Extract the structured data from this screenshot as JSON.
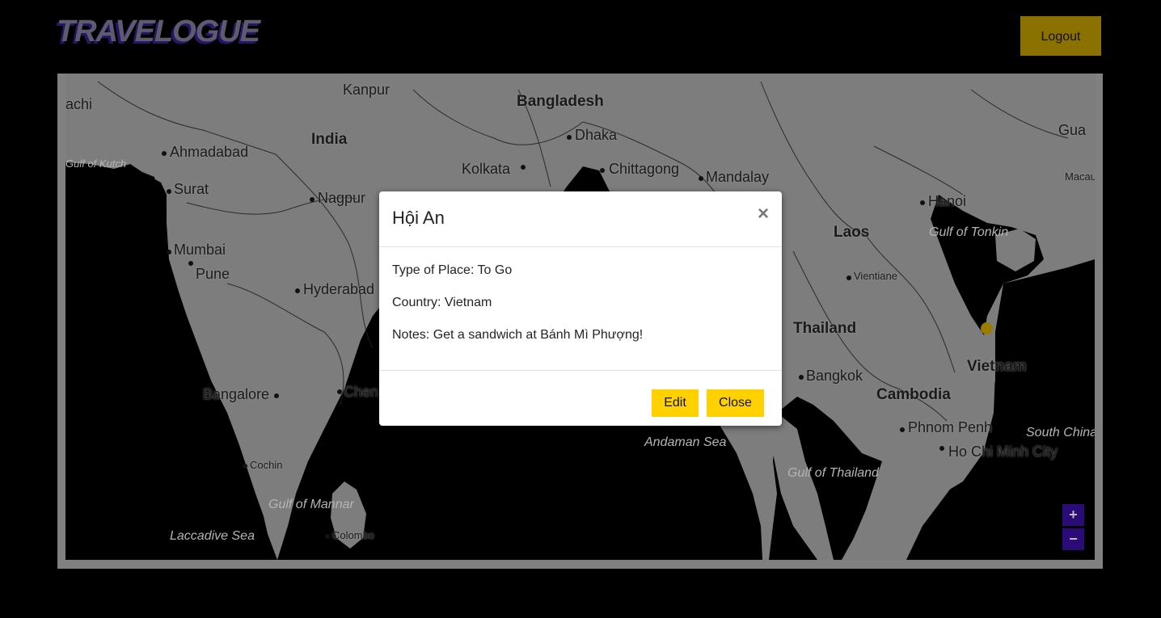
{
  "app": {
    "title": "TRAVELOGUE"
  },
  "header": {
    "logout_label": "Logout"
  },
  "map": {
    "labels": {
      "achi": "achi",
      "kanpur": "Kanpur",
      "bangladesh": "Bangladesh",
      "india": "India",
      "dhaka": "Dhaka",
      "ahmadabad": "Ahmadabad",
      "gulf_kutch": "Gulf of Kutch",
      "kolkata": "Kolkata",
      "chittagong": "Chittagong",
      "mandalay": "Mandalay",
      "gua": "Gua",
      "macau": "Macau",
      "surat": "Surat",
      "nagpur": "Nagpur",
      "hanoi": "Hanoi",
      "mumbai": "Mumbai",
      "laos": "Laos",
      "gulf_tonkin": "Gulf of Tonkin",
      "pune": "Pune",
      "vientiane": "Vientiane",
      "hyderabad": "Hyderabad",
      "thailand": "Thailand",
      "vietnam": "Vietnam",
      "bangkok": "Bangkok",
      "bangalore": "Bangalore",
      "chennai": "Chen",
      "cambodia": "Cambodia",
      "phnom_penh": "Phnom Penh",
      "south_china": "South China",
      "andaman_sea": "Andaman Sea",
      "hcmc": "Ho Chi Minh City",
      "cochin": "Cochin",
      "gulf_thailand": "Gulf of Thailand",
      "gulf_mannar": "Gulf of Mannar",
      "laccadive": "Laccadive Sea",
      "colombo": "Colombo"
    },
    "zoom_in_label": "+",
    "zoom_out_label": "−"
  },
  "modal": {
    "title": "Hội An",
    "close_glyph": "×",
    "type_of_place": "Type of Place: To Go",
    "country": "Country: Vietnam",
    "notes": "Notes: Get a sandwich at Bánh Mì Phượng!",
    "edit_label": "Edit",
    "close_label": "Close"
  }
}
